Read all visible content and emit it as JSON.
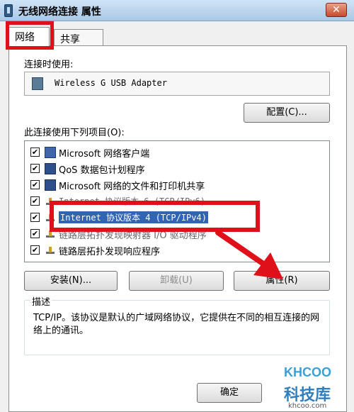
{
  "window": {
    "title": "无线网络连接 属性",
    "close_label": "✕"
  },
  "tabs": {
    "network": "网络",
    "sharing": "共享"
  },
  "connect_using": {
    "label": "连接时使用:",
    "adapter": "Wireless G USB Adapter",
    "configure_label": "配置(C)..."
  },
  "items_section": {
    "label": "此连接使用下列项目(O):",
    "items": [
      {
        "text": "Microsoft 网络客户端",
        "checked": true,
        "icon": "network-client-icon"
      },
      {
        "text": "QoS 数据包计划程序",
        "checked": true,
        "icon": "service-icon"
      },
      {
        "text": "Microsoft 网络的文件和打印机共享",
        "checked": true,
        "icon": "service-icon"
      },
      {
        "text": "Internet 协议版本 6 (TCP/IPv6)",
        "checked": true,
        "icon": "protocol-icon"
      },
      {
        "text": "Internet 协议版本 4 (TCP/IPv4)",
        "checked": true,
        "icon": "protocol-icon",
        "selected": true
      },
      {
        "text": "链路层拓扑发现映射器 I/O 驱动程序",
        "checked": true,
        "icon": "protocol-icon"
      },
      {
        "text": "链路层拓扑发现响应程序",
        "checked": true,
        "icon": "protocol-icon"
      }
    ],
    "check_mark": "✔"
  },
  "buttons": {
    "install": "安装(N)...",
    "uninstall": "卸载(U)",
    "properties": "属性(R)",
    "ok": "确定"
  },
  "description": {
    "title": "描述",
    "text": "TCP/IP。该协议是默认的广域网络协议，它提供在不同的相互连接的网络上的通讯。"
  },
  "watermark": {
    "logo": "KHCOO",
    "cn": "科技库",
    "url": "khcoo.com"
  },
  "colors": {
    "highlight": "#e0101a",
    "selection": "#3064b4"
  }
}
